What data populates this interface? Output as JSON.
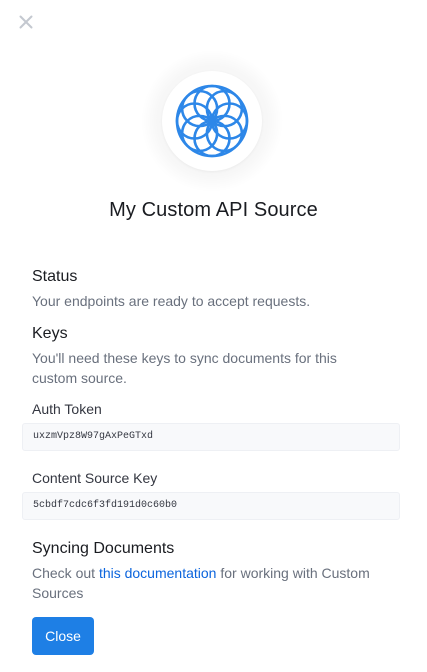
{
  "header": {
    "close_icon": "close-icon"
  },
  "source": {
    "logo_icon": "custom-api-source-icon",
    "title": "My Custom API Source"
  },
  "status": {
    "heading": "Status",
    "text": "Your endpoints are ready to accept requests."
  },
  "keys": {
    "heading": "Keys",
    "text": "You'll need these keys to sync documents for this custom source.",
    "auth_token_label": "Auth Token",
    "auth_token_value": "uxzmVpz8W97gAxPeGTxd",
    "content_source_key_label": "Content Source Key",
    "content_source_key_value": "5cbdf7cdc6f3fd191d0c60b0"
  },
  "syncing": {
    "heading": "Syncing Documents",
    "text_before": "Check out ",
    "link_text": "this documentation",
    "text_after": " for working with Custom Sources"
  },
  "footer": {
    "close_label": "Close"
  },
  "colors": {
    "accent": "#1e7fe5",
    "link": "#0b64dd",
    "logo": "#2d87e8",
    "muted_text": "#69707d"
  }
}
